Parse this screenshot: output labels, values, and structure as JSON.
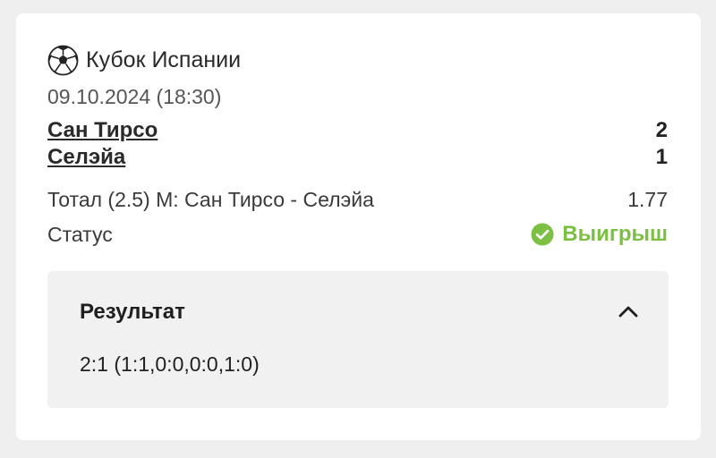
{
  "tournament": {
    "icon": "soccer-ball-icon",
    "name": "Кубок Испании"
  },
  "match": {
    "datetime": "09.10.2024 (18:30)",
    "team1": {
      "name": "Сан Тирсо",
      "score": "2"
    },
    "team2": {
      "name": "Селэйа",
      "score": "1"
    }
  },
  "bet": {
    "label": "Тотал (2.5) М: Сан Тирсо - Селэйа",
    "odds": "1.77"
  },
  "status": {
    "label": "Статус",
    "value": "Выигрыш",
    "icon": "check-circle-icon",
    "color": "#7bc043"
  },
  "result": {
    "title": "Результат",
    "toggle_icon": "chevron-up-icon",
    "details": "2:1 (1:1,0:0,0:0,1:0)"
  }
}
